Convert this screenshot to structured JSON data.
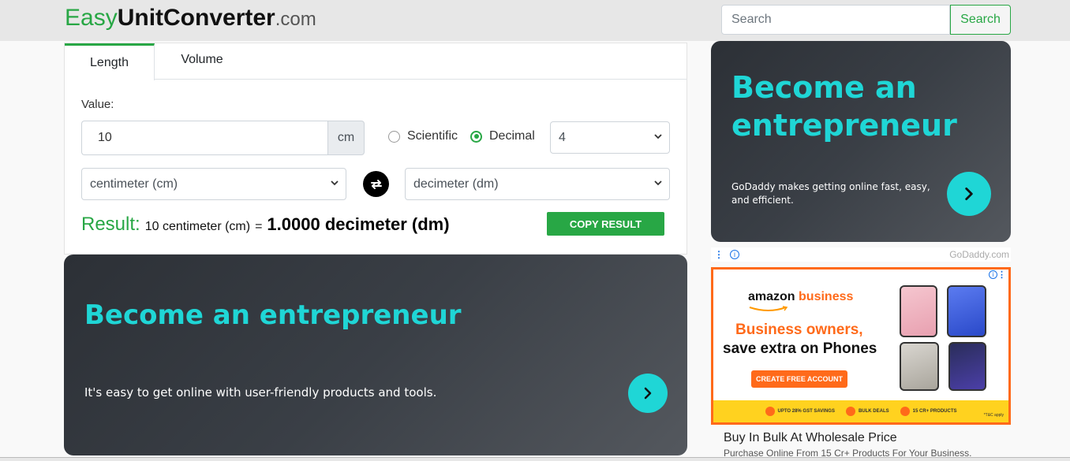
{
  "header": {
    "logo": {
      "part1": "Easy",
      "part2": "UnitConverter",
      "part3": ".com"
    },
    "search": {
      "placeholder": "Search",
      "button_label": "Search"
    }
  },
  "converter": {
    "tabs": [
      {
        "label": "Length",
        "active": true
      },
      {
        "label": "Volume",
        "active": false
      }
    ],
    "value_label": "Value:",
    "value": "10",
    "unit_addon": "cm",
    "format_options": [
      {
        "label": "Scientific",
        "selected": false
      },
      {
        "label": "Decimal",
        "selected": true
      }
    ],
    "decimal_places": "4",
    "from_unit": "centimeter (cm)",
    "to_unit": "decimeter (dm)",
    "result": {
      "label": "Result:",
      "from_text": "10 centimeter (cm)",
      "equals": "=",
      "to_text": "1.0000 decimeter (dm)"
    },
    "copy_button_label": "COPY RESULT"
  },
  "ads": {
    "main": {
      "headline": "Become an entrepreneur",
      "subtext": "It's easy to get online with user-friendly products and tools."
    },
    "side": {
      "headline": "Become an entrepreneur",
      "subtext": "GoDaddy makes getting online fast, easy, and efficient.",
      "source": "GoDaddy.com"
    },
    "amazon": {
      "brand_part1": "amazon",
      "brand_part2": "business",
      "headline1": "Business owners,",
      "headline2": "save extra on Phones",
      "cta": "CREATE FREE ACCOUNT",
      "strip_items": [
        "UPTO 28% GST SAVINGS",
        "BULK DEALS",
        "15 CR+ PRODUCTS"
      ],
      "tc": "*T&C apply"
    },
    "bulk": {
      "title": "Buy In Bulk At Wholesale Price",
      "subtitle": "Purchase Online From 15 Cr+ Products For Your Business."
    }
  },
  "colors": {
    "brand_green": "#28a745",
    "ad_teal": "#1fd6d6",
    "amazon_orange": "#ff6a1a"
  }
}
